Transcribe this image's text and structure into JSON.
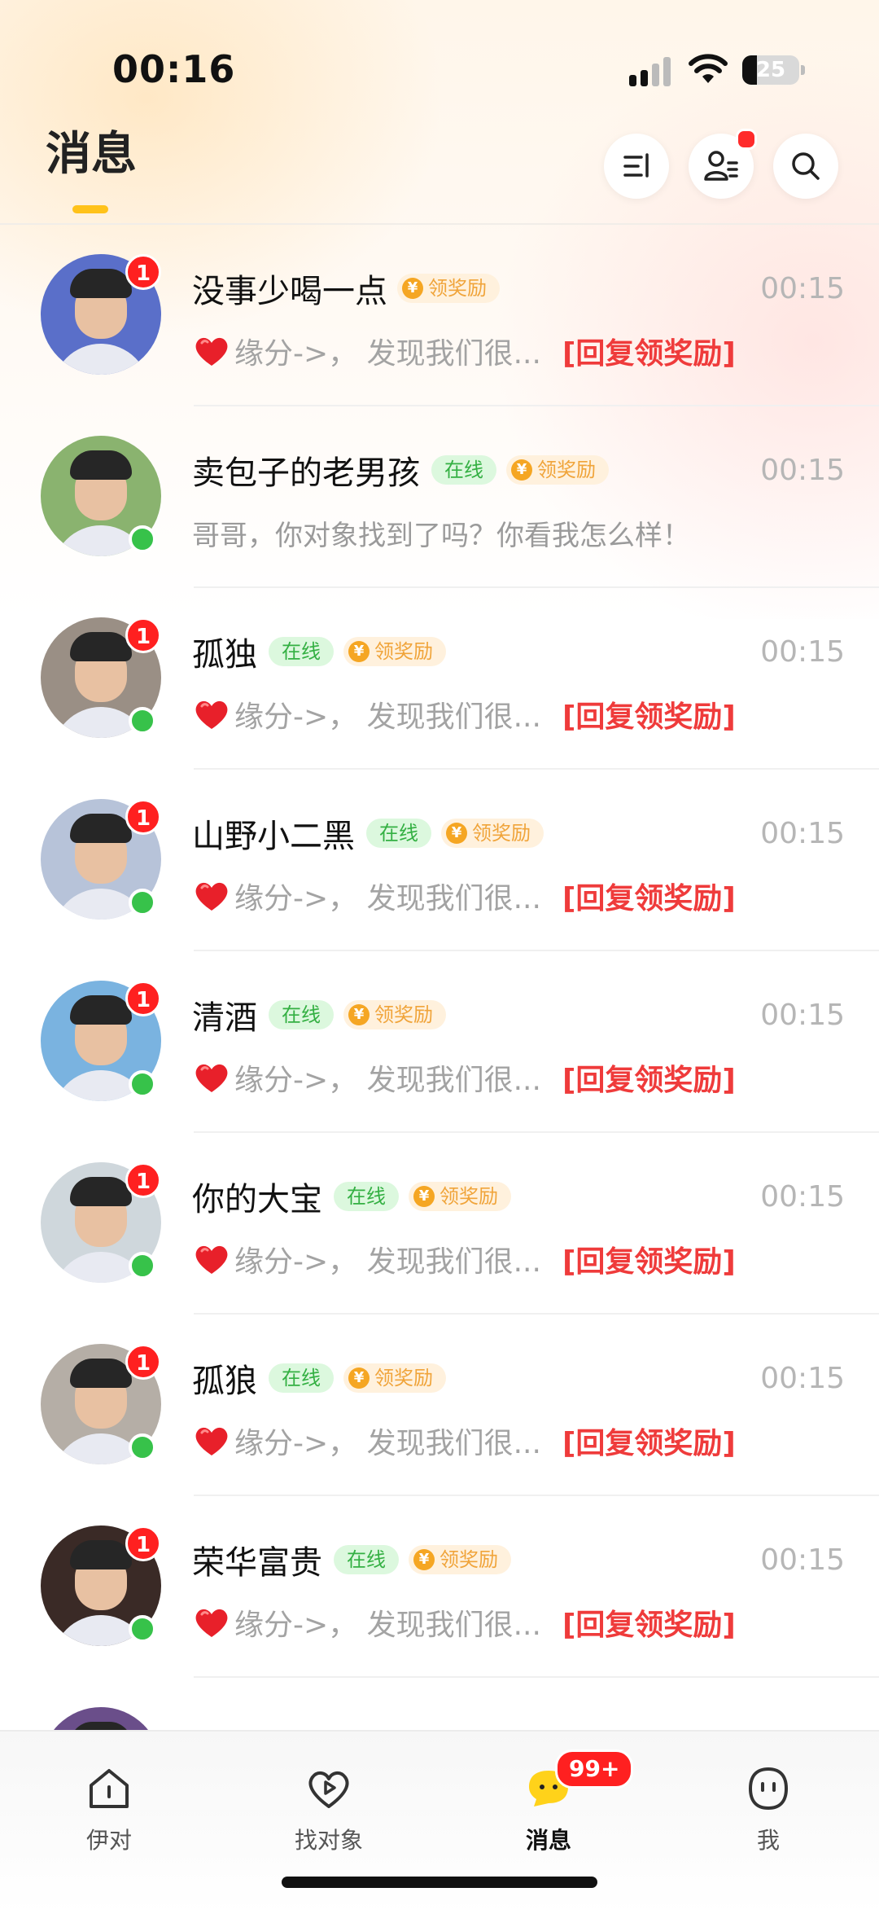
{
  "status_bar": {
    "time": "00:16",
    "battery": "25"
  },
  "header": {
    "title": "消息"
  },
  "conversations": [
    {
      "name": "没事少喝一点",
      "online": false,
      "online_label": "",
      "reward_label": "领奖励",
      "time": "00:15",
      "unread": "1",
      "heart": true,
      "message": "缘分->，  发现我们很...",
      "reply_label": "[回复领奖励]",
      "avatar_color": "#5a6fc9"
    },
    {
      "name": "卖包子的老男孩",
      "online": true,
      "online_label": "在线",
      "reward_label": "领奖励",
      "time": "00:15",
      "unread": "",
      "heart": false,
      "message": "哥哥，你对象找到了吗？你看我怎么样！",
      "reply_label": "",
      "avatar_color": "#8ab36f"
    },
    {
      "name": "孤独",
      "online": true,
      "online_label": "在线",
      "reward_label": "领奖励",
      "time": "00:15",
      "unread": "1",
      "heart": true,
      "message": "缘分->，  发现我们很...",
      "reply_label": "[回复领奖励]",
      "avatar_color": "#9a8f85"
    },
    {
      "name": "山野小二黑",
      "online": true,
      "online_label": "在线",
      "reward_label": "领奖励",
      "time": "00:15",
      "unread": "1",
      "heart": true,
      "message": "缘分->，  发现我们很...",
      "reply_label": "[回复领奖励]",
      "avatar_color": "#b7c3d9"
    },
    {
      "name": "清酒",
      "online": true,
      "online_label": "在线",
      "reward_label": "领奖励",
      "time": "00:15",
      "unread": "1",
      "heart": true,
      "message": "缘分->，  发现我们很...",
      "reply_label": "[回复领奖励]",
      "avatar_color": "#7ab3e0"
    },
    {
      "name": "你的大宝",
      "online": true,
      "online_label": "在线",
      "reward_label": "领奖励",
      "time": "00:15",
      "unread": "1",
      "heart": true,
      "message": "缘分->，  发现我们很...",
      "reply_label": "[回复领奖励]",
      "avatar_color": "#cfd7dc"
    },
    {
      "name": "孤狼",
      "online": true,
      "online_label": "在线",
      "reward_label": "领奖励",
      "time": "00:15",
      "unread": "1",
      "heart": true,
      "message": "缘分->，  发现我们很...",
      "reply_label": "[回复领奖励]",
      "avatar_color": "#b5aea6"
    },
    {
      "name": "荣华富贵",
      "online": true,
      "online_label": "在线",
      "reward_label": "领奖励",
      "time": "00:15",
      "unread": "1",
      "heart": true,
      "message": "缘分->，  发现我们很...",
      "reply_label": "[回复领奖励]",
      "avatar_color": "#3a2a26"
    },
    {
      "name": "",
      "online": false,
      "online_label": "",
      "reward_label": "",
      "time": "",
      "unread": "",
      "heart": false,
      "message": "",
      "reply_label": "",
      "avatar_color": "#6a4e8a"
    }
  ],
  "tab_bar": {
    "tabs": [
      {
        "label": "伊对",
        "icon": "home-icon"
      },
      {
        "label": "找对象",
        "icon": "heart-play-icon"
      },
      {
        "label": "消息",
        "icon": "chat-bubble-icon",
        "badge": "99+"
      },
      {
        "label": "我",
        "icon": "profile-face-icon"
      }
    ]
  },
  "colors": {
    "accent": "#ffc21a",
    "unread": "#ff2020",
    "online": "#37c24a",
    "reply": "#ef3b3b"
  }
}
